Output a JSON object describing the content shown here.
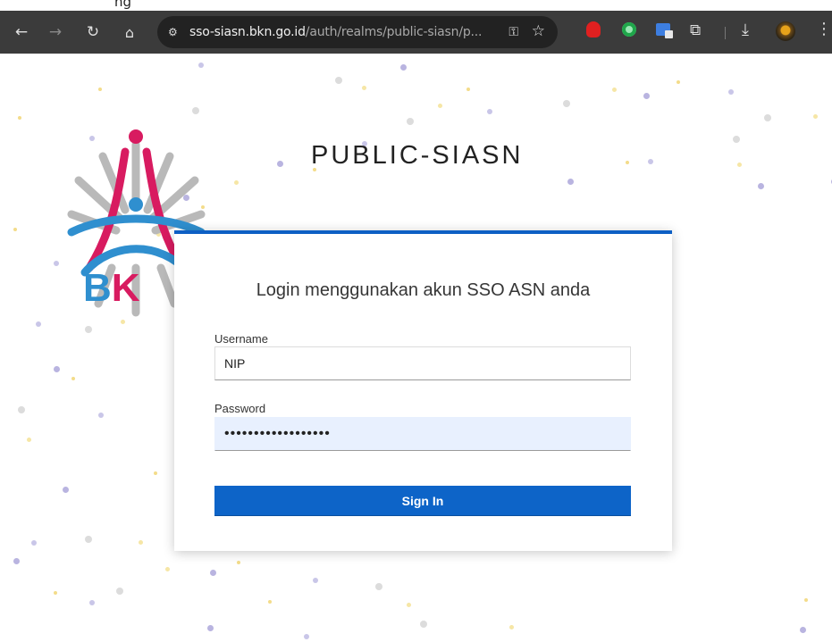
{
  "window": {
    "title_fragment": "ng"
  },
  "browser": {
    "nav_icons": [
      "back-arrow-icon",
      "forward-arrow-icon",
      "reload-icon",
      "home-icon"
    ],
    "url_host": "sso-siasn.bkn.go.id",
    "url_path": "/auth/realms/public-siasn/p...",
    "site_info_icon": "tune-icon",
    "toolbar_icons": [
      "key-icon",
      "star-icon",
      "red-extension-icon",
      "green-extension-icon",
      "translate-extension-icon",
      "puzzle-icon",
      "download-icon",
      "profile-avatar",
      "more-menu-icon"
    ],
    "colors": {
      "toolbar": "#3b3b3b",
      "omnibox": "#222222"
    }
  },
  "page": {
    "realm_title": "PUBLIC-SIASN",
    "logo": {
      "text_b": "B",
      "text_k": "K"
    },
    "login": {
      "heading": "Login menggunakan akun SSO ASN anda",
      "username_label": "Username",
      "username_value": "NIP",
      "password_label": "Password",
      "password_value": "••••••••••••••••••",
      "signin_label": "Sign In"
    },
    "colors": {
      "accent": "#0d64c8",
      "brand_blue": "#2f8fcf",
      "brand_pink": "#d81b60",
      "autofill": "#e8f0fe"
    }
  }
}
